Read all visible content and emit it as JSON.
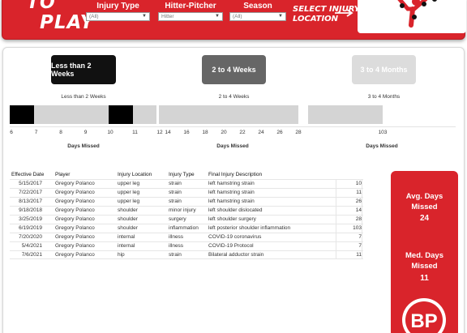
{
  "header": {
    "title_top": "TO",
    "title_bottom": "PLAY",
    "filters": [
      {
        "label": "Injury Type",
        "value": "(All)"
      },
      {
        "label": "Hitter-Pitcher",
        "value": "Hitter"
      },
      {
        "label": "Season",
        "value": "(All)"
      }
    ],
    "select_hint_line1": "SELECT INJURY",
    "select_hint_line2": "LOCATION",
    "colors": {
      "brand_red": "#d9242b",
      "white": "#ffffff"
    }
  },
  "range_buttons": [
    {
      "label": "Less than 2 Weeks",
      "state": "selected"
    },
    {
      "label": "2 to 4 Weeks",
      "state": "active"
    },
    {
      "label": "3 to 4 Months",
      "state": "disabled"
    }
  ],
  "timelines": {
    "titles": [
      "Less than 2 Weeks",
      "2 to 4 Weeks",
      "3 to 4 Months"
    ],
    "ticks_lt2": [
      "6",
      "7",
      "8",
      "9",
      "10",
      "11",
      "12"
    ],
    "ticks_2to4": [
      "14",
      "16",
      "18",
      "20",
      "22",
      "24",
      "26",
      "28"
    ],
    "ticks_3to4": [
      "103"
    ],
    "axis_label": "Days Missed",
    "marks_lt2": [
      7,
      10,
      11,
      11
    ],
    "marks_2to4": [
      14,
      26,
      28
    ],
    "marks_3to4": [
      103
    ]
  },
  "table": {
    "headers": {
      "date": "Effective Date",
      "player": "Player",
      "location": "Injury Location",
      "type": "Injury Type",
      "description": "Final Injury Description",
      "days": ""
    },
    "rows": [
      {
        "date": "5/15/2017",
        "player": "Gregory Polanco",
        "location": "upper leg",
        "type": "strain",
        "description": "left hamstring strain",
        "days": "10"
      },
      {
        "date": "7/22/2017",
        "player": "Gregory Polanco",
        "location": "upper leg",
        "type": "strain",
        "description": "left hamstring strain",
        "days": "11"
      },
      {
        "date": "8/13/2017",
        "player": "Gregory Polanco",
        "location": "upper leg",
        "type": "strain",
        "description": "left hamstring strain",
        "days": "26"
      },
      {
        "date": "9/18/2018",
        "player": "Gregory Polanco",
        "location": "shoulder",
        "type": "minor injury",
        "description": "left shoulder dislocated",
        "days": "14"
      },
      {
        "date": "3/25/2019",
        "player": "Gregory Polanco",
        "location": "shoulder",
        "type": "surgery",
        "description": "left shoulder surgery",
        "days": "28"
      },
      {
        "date": "6/19/2019",
        "player": "Gregory Polanco",
        "location": "shoulder",
        "type": "inflammation",
        "description": "left posterior shoulder inflammation",
        "days": "103"
      },
      {
        "date": "7/20/2020",
        "player": "Gregory Polanco",
        "location": "internal",
        "type": "illness",
        "description": "COVID-19 coronavirus",
        "days": "7"
      },
      {
        "date": "5/4/2021",
        "player": "Gregory Polanco",
        "location": "internal",
        "type": "illness",
        "description": "COVID-19 Protocol",
        "days": "7"
      },
      {
        "date": "7/6/2021",
        "player": "Gregory Polanco",
        "location": "hip",
        "type": "strain",
        "description": "Bilateral adductor strain",
        "days": "11"
      }
    ]
  },
  "stats": {
    "avg_label_line1": "Avg. Days",
    "avg_label_line2": "Missed",
    "avg_value": "24",
    "med_label_line1": "Med. Days",
    "med_label_line2": "Missed",
    "med_value": "11",
    "logo_text": "BP"
  }
}
